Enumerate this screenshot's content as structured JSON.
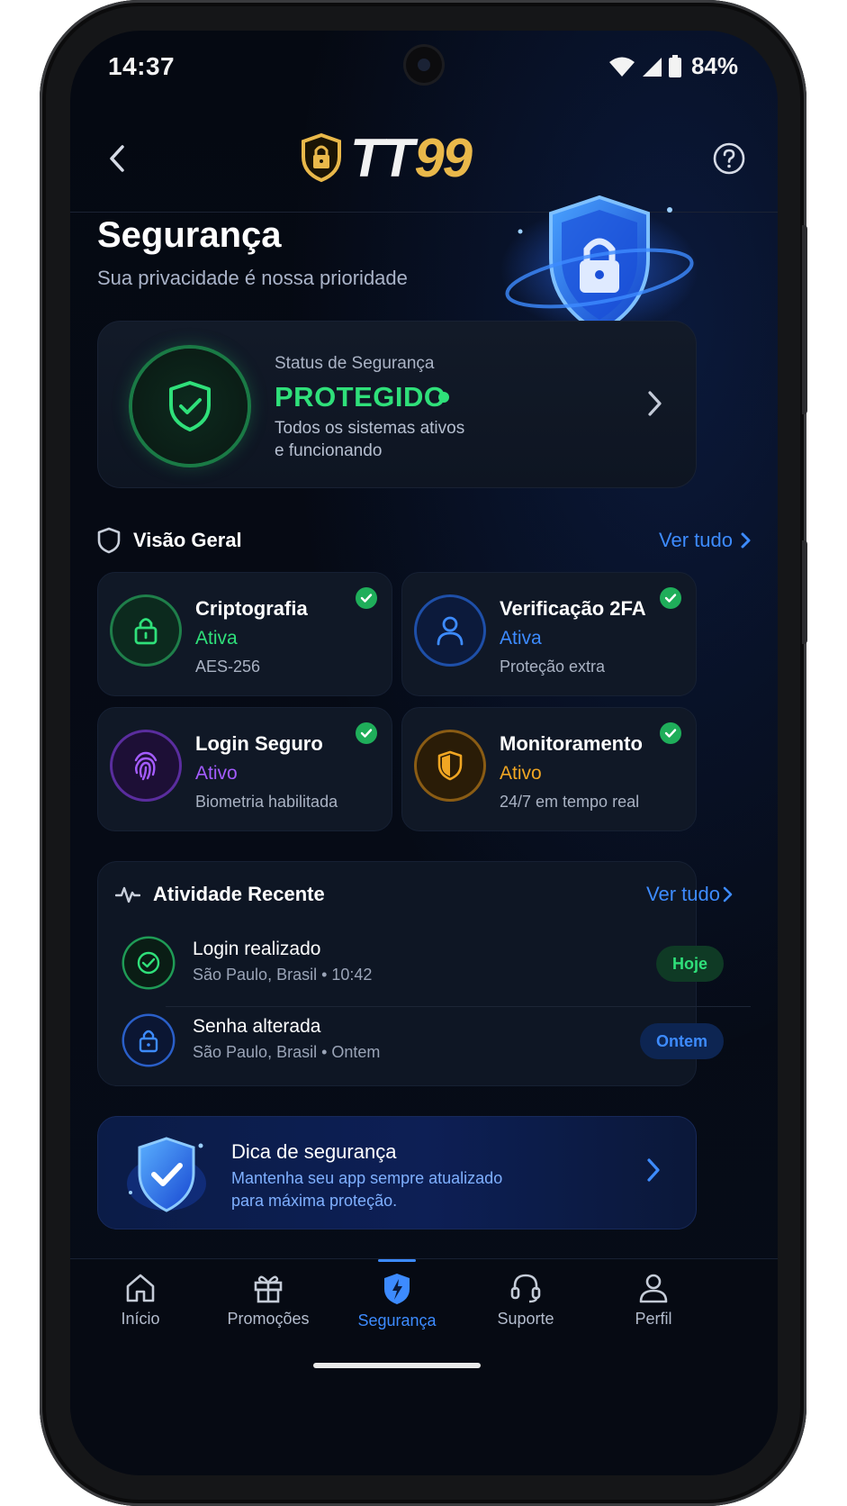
{
  "status_bar": {
    "time": "14:37",
    "battery": "84%"
  },
  "header": {
    "logo_part1": "TT",
    "logo_part2": "99"
  },
  "hero": {
    "title": "Segurança",
    "subtitle": "Sua privacidade é nossa prioridade"
  },
  "security_status": {
    "label": "Status de Segurança",
    "value": "PROTEGIDO",
    "desc_line1": "Todos os sistemas ativos",
    "desc_line2": "e funcionando",
    "value_color": "#2fe07a"
  },
  "overview": {
    "title": "Visão Geral",
    "link": "Ver tudo",
    "cards": [
      {
        "title": "Criptografia",
        "status": "Ativa",
        "desc": "AES-256",
        "icon": "lock-icon",
        "color": "#2fe07a"
      },
      {
        "title": "Verificação 2FA",
        "status": "Ativa",
        "desc": "Proteção extra",
        "icon": "user-icon",
        "color": "#3d8bff"
      },
      {
        "title": "Login Seguro",
        "status": "Ativo",
        "desc": "Biometria habilitada",
        "icon": "fingerprint-icon",
        "color": "#a45cff"
      },
      {
        "title": "Monitoramento",
        "status": "Ativo",
        "desc": "24/7 em tempo real",
        "icon": "shield-icon",
        "color": "#f0a623"
      }
    ]
  },
  "activity": {
    "title": "Atividade Recente",
    "link": "Ver tudo",
    "items": [
      {
        "title": "Login realizado",
        "subtitle": "São Paulo, Brasil • 10:42",
        "badge": "Hoje",
        "icon": "check-circle-icon"
      },
      {
        "title": "Senha alterada",
        "subtitle": "São Paulo, Brasil • Ontem",
        "badge": "Ontem",
        "icon": "lock-icon"
      }
    ]
  },
  "tip": {
    "title": "Dica de segurança",
    "line1": "Mantenha seu app sempre atualizado",
    "line2": "para máxima proteção."
  },
  "nav": {
    "items": [
      {
        "label": "Início",
        "icon": "home-icon"
      },
      {
        "label": "Promoções",
        "icon": "gift-icon"
      },
      {
        "label": "Segurança",
        "icon": "shield-icon",
        "active": true
      },
      {
        "label": "Suporte",
        "icon": "headset-icon"
      },
      {
        "label": "Perfil",
        "icon": "person-icon"
      }
    ]
  },
  "colors": {
    "accent": "#3d8bff",
    "success": "#2fe07a",
    "purple": "#a45cff",
    "orange": "#f0a623",
    "gold": "#e9b84a"
  }
}
